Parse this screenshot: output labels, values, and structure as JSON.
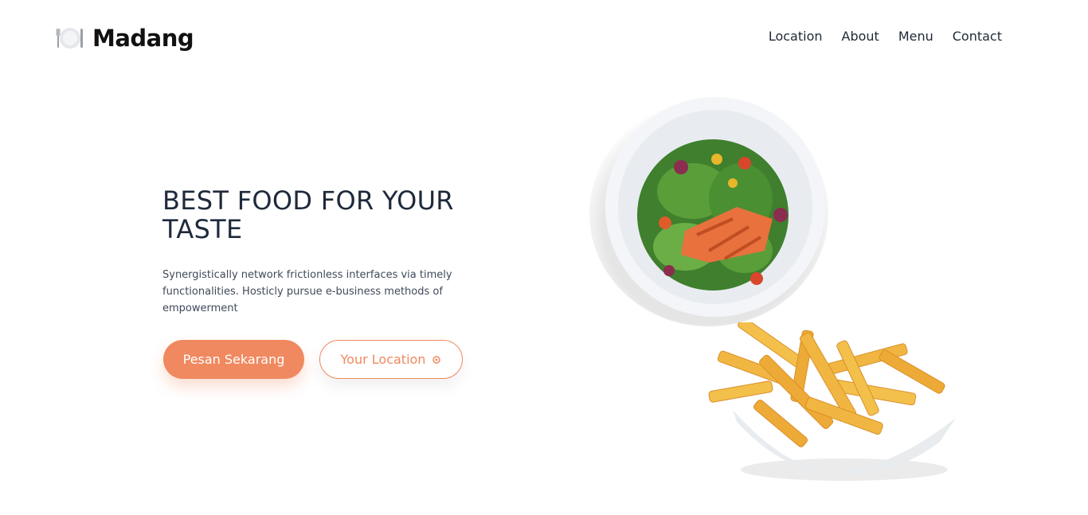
{
  "brand": {
    "name": "Madang",
    "icon": "plate-cutlery-icon"
  },
  "nav": {
    "items": [
      "Location",
      "About",
      "Menu",
      "Contact"
    ]
  },
  "hero": {
    "title_line1": "BEST FOOD FOR YOUR",
    "title_line2": "TASTE",
    "description": "Synergistically network frictionless interfaces via timely functionalities. Hosticly pursue e-business methods of empowerment",
    "primary_button": "Pesan Sekarang",
    "secondary_button": "Your Location",
    "secondary_icon": "location-icon"
  },
  "images": {
    "salad": "salmon-salad-plate",
    "fries": "french-fries-paper-tray"
  },
  "colors": {
    "accent": "#f0895f",
    "heading": "#1e2a3b",
    "text": "#3f4a5a"
  }
}
